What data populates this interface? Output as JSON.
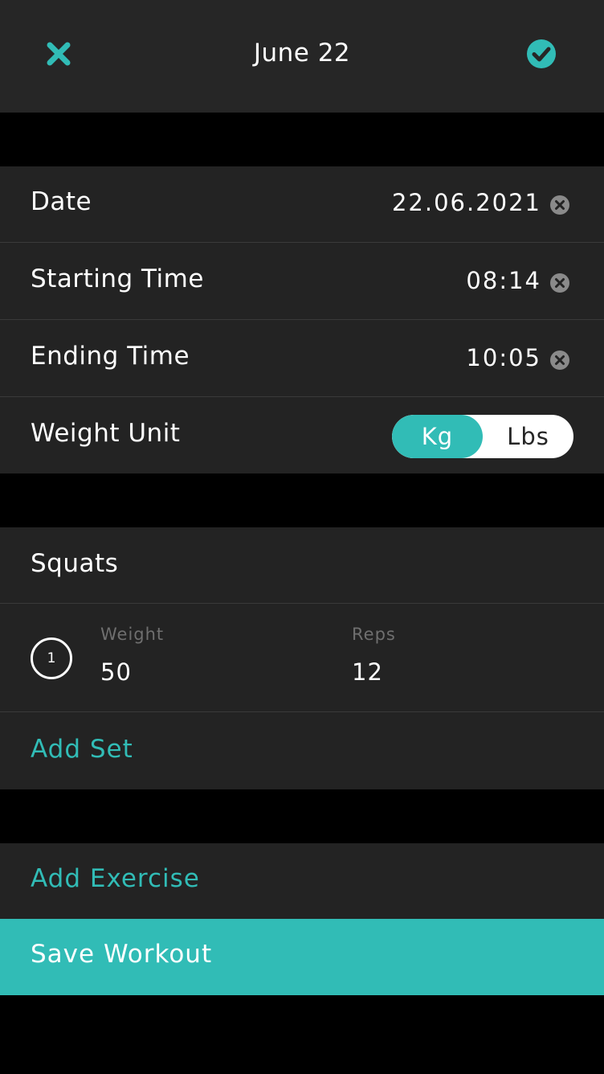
{
  "header": {
    "title": "June 22",
    "close_icon": "close-x-icon",
    "confirm_icon": "check-circle-icon",
    "accent_color": "#31bcb6"
  },
  "details": {
    "date": {
      "label": "Date",
      "value": "22.06.2021"
    },
    "start_time": {
      "label": "Starting Time",
      "value": "08:14"
    },
    "end_time": {
      "label": "Ending Time",
      "value": "10:05"
    },
    "weight_unit": {
      "label": "Weight Unit",
      "options": [
        "Kg",
        "Lbs"
      ],
      "selected": "Kg"
    }
  },
  "exercise": {
    "name": "Squats",
    "weight_label": "Weight",
    "reps_label": "Reps",
    "sets": [
      {
        "number": "1",
        "weight": "50",
        "reps": "12"
      }
    ],
    "add_set_label": "Add Set"
  },
  "actions": {
    "add_exercise_label": "Add Exercise",
    "save_workout_label": "Save Workout"
  }
}
